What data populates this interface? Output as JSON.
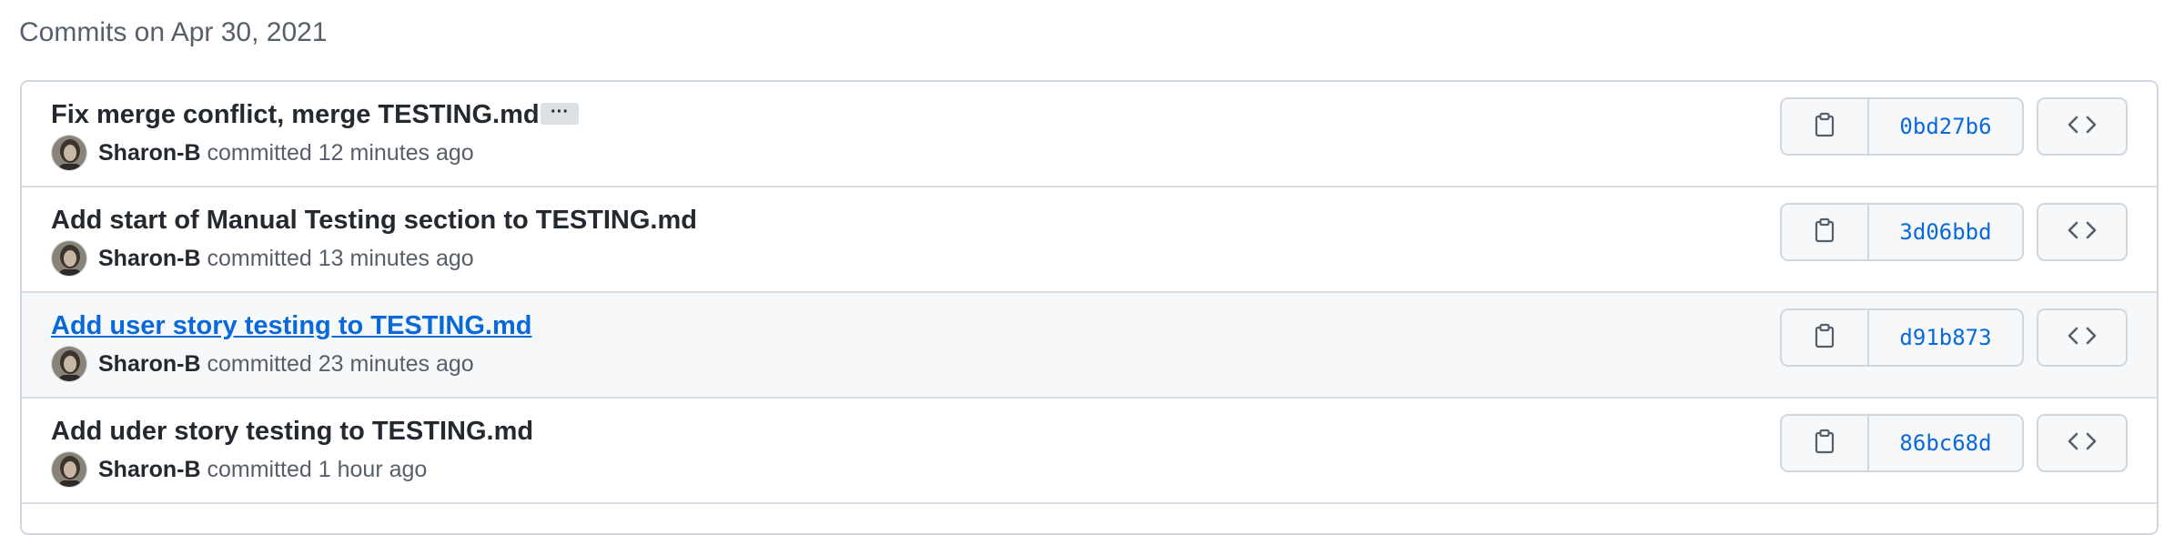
{
  "header": {
    "title": "Commits on Apr 30, 2021"
  },
  "commits": [
    {
      "message": "Fix merge conflict, merge TESTING.md",
      "author": "Sharon-B",
      "time": "committed 12 minutes ago",
      "sha": "0bd27b6",
      "ellipsis": "···"
    },
    {
      "message": "Add start of Manual Testing section to TESTING.md",
      "author": "Sharon-B",
      "time": "committed 13 minutes ago",
      "sha": "3d06bbd"
    },
    {
      "message": "Add user story testing to TESTING.md",
      "author": "Sharon-B",
      "time": "committed 23 minutes ago",
      "sha": "d91b873"
    },
    {
      "message": "Add uder story testing to TESTING.md",
      "author": "Sharon-B",
      "time": "committed 1 hour ago",
      "sha": "86bc68d"
    }
  ],
  "icons": {
    "copy": "clipboard-icon",
    "browse": "code-icon"
  },
  "colors": {
    "link": "#0969da",
    "muted": "#57606a",
    "border": "#d0d7de",
    "hover_row": "#f6f8fa"
  }
}
